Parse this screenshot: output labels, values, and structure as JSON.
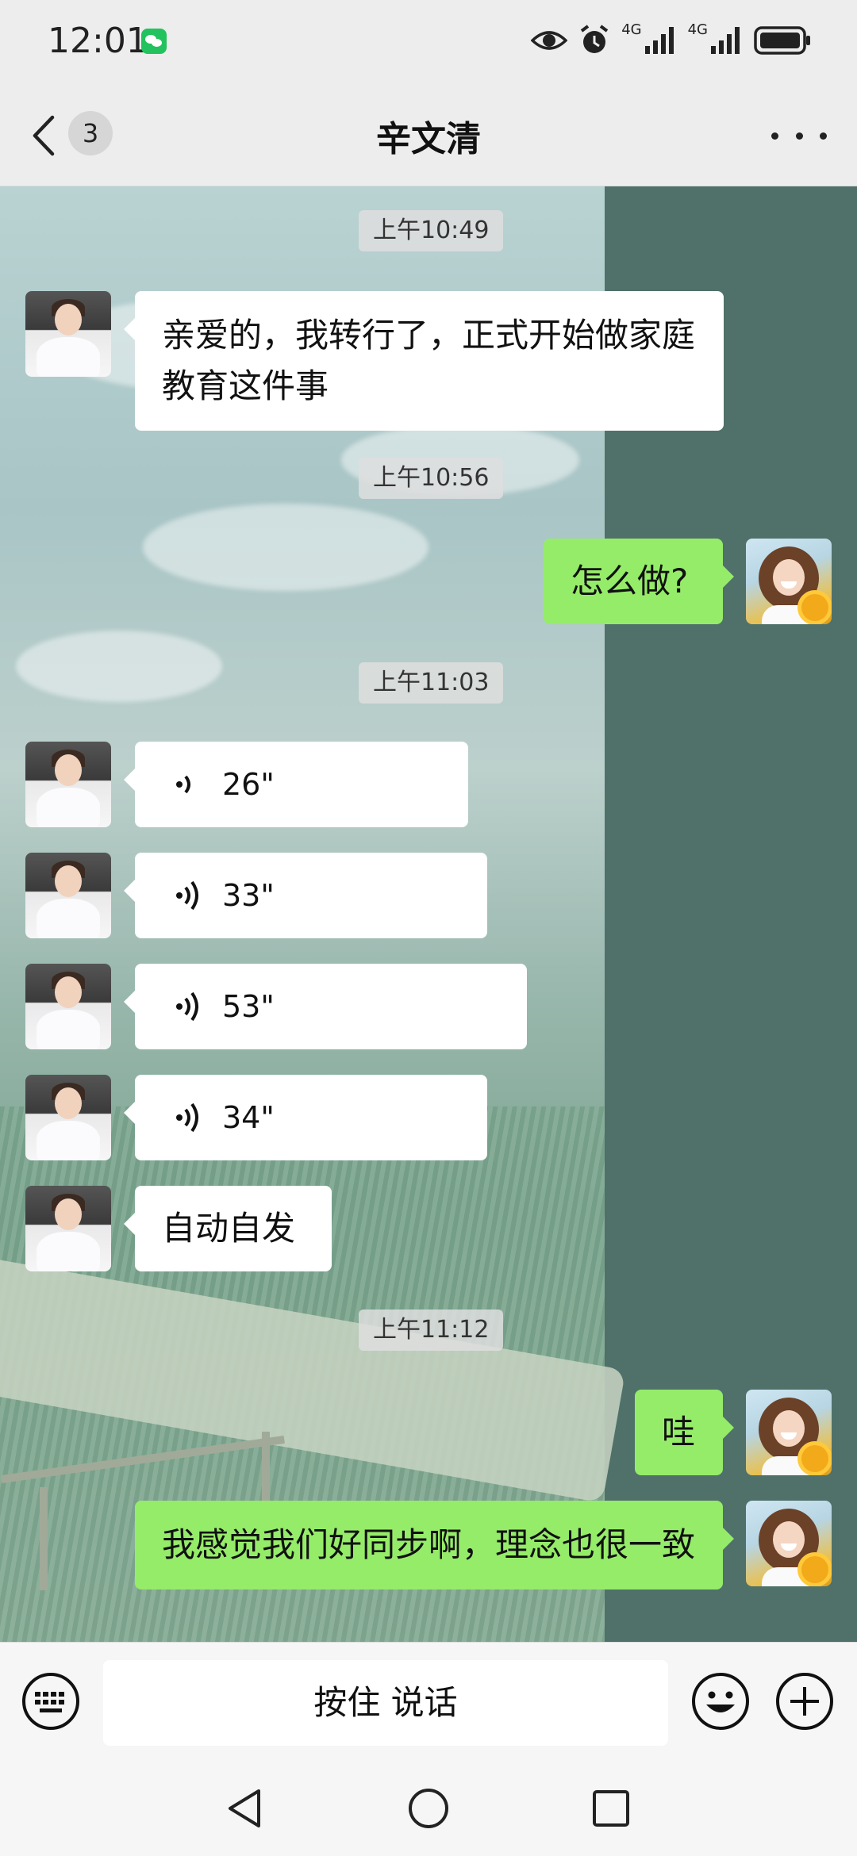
{
  "status_bar": {
    "time": "12:01",
    "network_1": "4G",
    "network_2": "4G",
    "icons": [
      "wechat-notification-icon",
      "eye-icon",
      "alarm-icon",
      "signal-icon",
      "battery-icon"
    ]
  },
  "header": {
    "unread_count": "3",
    "title": "辛文清",
    "back_icon": "chevron-left-icon",
    "more_icon": "more-dots-icon"
  },
  "messages": [
    {
      "type": "time",
      "text": "上午10:49"
    },
    {
      "type": "text",
      "side": "in",
      "text": "亲爱的，我转行了，正式开始做家庭教育这件事"
    },
    {
      "type": "time",
      "text": "上午10:56"
    },
    {
      "type": "text",
      "side": "out",
      "text": "怎么做?"
    },
    {
      "type": "time",
      "text": "上午11:03"
    },
    {
      "type": "voice",
      "side": "in",
      "duration": "26\""
    },
    {
      "type": "voice",
      "side": "in",
      "duration": "33\""
    },
    {
      "type": "voice",
      "side": "in",
      "duration": "53\""
    },
    {
      "type": "voice",
      "side": "in",
      "duration": "34\""
    },
    {
      "type": "text",
      "side": "in",
      "text": "自动自发"
    },
    {
      "type": "time",
      "text": "上午11:12"
    },
    {
      "type": "text",
      "side": "out",
      "text": "哇"
    },
    {
      "type": "text",
      "side": "out",
      "text": "我感觉我们好同步啊，理念也很一致"
    }
  ],
  "input_bar": {
    "hold_to_talk": "按住 说话",
    "keyboard_icon": "keyboard-icon",
    "emoji_icon": "emoji-icon",
    "plus_icon": "plus-icon"
  },
  "nav_bar": {
    "icons": [
      "back-triangle-icon",
      "home-circle-icon",
      "recents-square-icon"
    ]
  },
  "colors": {
    "bubble_out": "#95ec69",
    "bubble_in": "#ffffff",
    "header_bg": "#ededed",
    "right_panel": "#4f716a"
  }
}
